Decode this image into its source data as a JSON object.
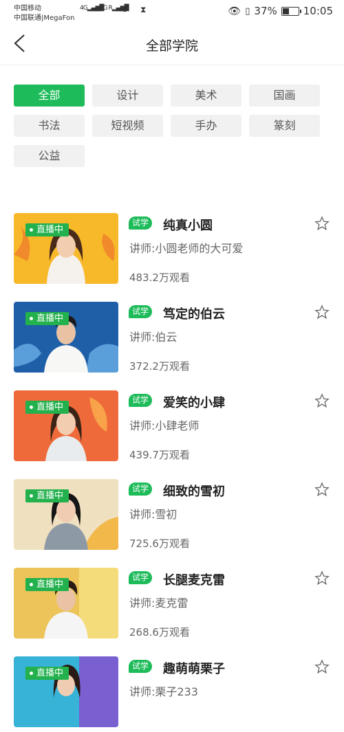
{
  "status_bar": {
    "carrier_1": "中国移动",
    "carrier_2": "中国联通|MegaFon",
    "signal_1": "4G",
    "signal_2": "4G R",
    "battery_percent": "37%",
    "time": "10:05"
  },
  "header": {
    "title": "全部学院"
  },
  "categories": [
    {
      "label": "全部",
      "active": true
    },
    {
      "label": "设计",
      "active": false
    },
    {
      "label": "美术",
      "active": false
    },
    {
      "label": "国画",
      "active": false
    },
    {
      "label": "书法",
      "active": false
    },
    {
      "label": "短视频",
      "active": false
    },
    {
      "label": "手办",
      "active": false
    },
    {
      "label": "篆刻",
      "active": false
    },
    {
      "label": "公益",
      "active": false
    }
  ],
  "courses": [
    {
      "live": "直播中",
      "badge": "试学",
      "name": "纯真小圆",
      "teacher": "讲师:小圆老师的大可爱",
      "views": "483.2万观看"
    },
    {
      "live": "直播中",
      "badge": "试学",
      "name": "笃定的伯云",
      "teacher": "讲师:伯云",
      "views": "372.2万观看"
    },
    {
      "live": "直播中",
      "badge": "试学",
      "name": "爱笑的小肆",
      "teacher": "讲师:小肆老师",
      "views": "439.7万观看"
    },
    {
      "live": "直播中",
      "badge": "试学",
      "name": "细致的雪初",
      "teacher": "讲师:雪初",
      "views": "725.6万观看"
    },
    {
      "live": "直播中",
      "badge": "试学",
      "name": "长腿麦克雷",
      "teacher": "讲师:麦克雷",
      "views": "268.6万观看"
    },
    {
      "live": "直播中",
      "badge": "试学",
      "name": "趣萌萌栗子",
      "teacher": "讲师:栗子233",
      "views": ""
    }
  ],
  "colors": {
    "accent": "#1dbb59"
  }
}
